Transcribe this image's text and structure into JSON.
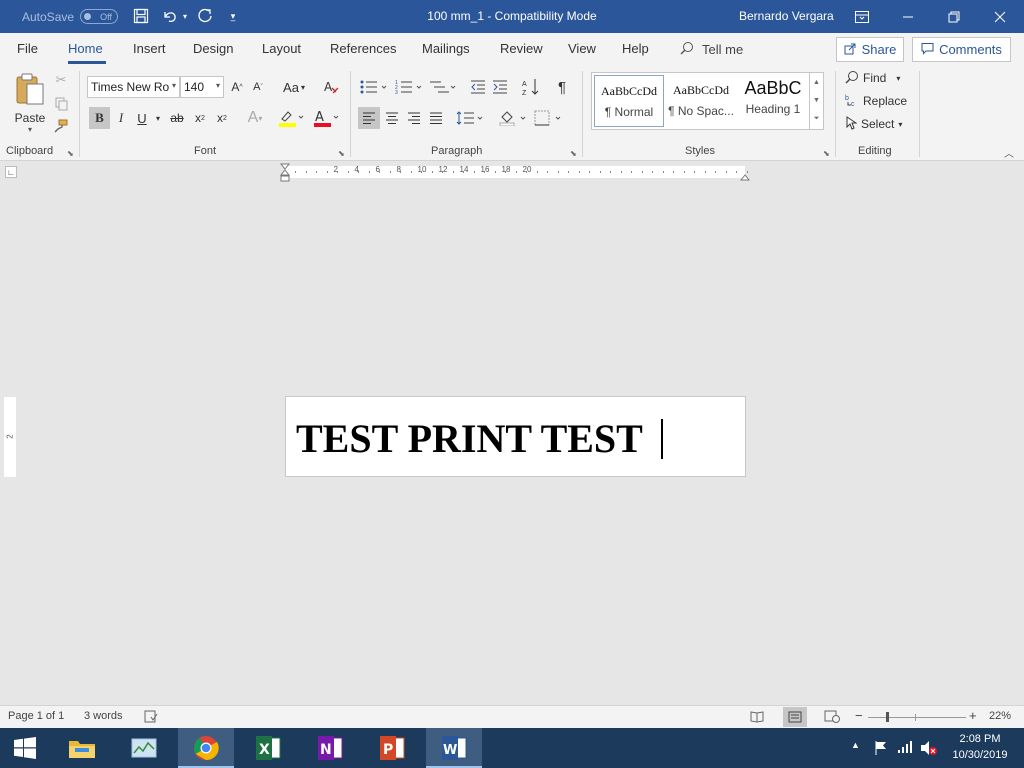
{
  "titlebar": {
    "autosave_label": "AutoSave",
    "autosave_state": "Off",
    "doc_title": "100 mm_1  -  Compatibility Mode",
    "user_name": "Bernardo Vergara"
  },
  "tabs": [
    {
      "label": "File"
    },
    {
      "label": "Home",
      "active": true
    },
    {
      "label": "Insert"
    },
    {
      "label": "Design"
    },
    {
      "label": "Layout"
    },
    {
      "label": "References"
    },
    {
      "label": "Mailings"
    },
    {
      "label": "Review"
    },
    {
      "label": "View"
    },
    {
      "label": "Help"
    }
  ],
  "tellme_label": "Tell me",
  "share_label": "Share",
  "comments_label": "Comments",
  "ribbon": {
    "clipboard": {
      "paste_label": "Paste",
      "group_label": "Clipboard"
    },
    "font": {
      "font_name": "Times New Ro",
      "font_size": "140",
      "change_case_label": "Aa",
      "group_label": "Font"
    },
    "paragraph": {
      "group_label": "Paragraph"
    },
    "styles": {
      "group_label": "Styles",
      "items": [
        {
          "preview": "AaBbCcDd",
          "name": "¶ Normal"
        },
        {
          "preview": "AaBbCcDd",
          "name": "¶ No Spac..."
        },
        {
          "preview": "AaBbC",
          "name": "Heading 1"
        }
      ]
    },
    "editing": {
      "find_label": "Find",
      "replace_label": "Replace",
      "select_label": "Select",
      "group_label": "Editing"
    }
  },
  "ruler_numbers": [
    "2",
    "4",
    "6",
    "8",
    "10",
    "12",
    "14",
    "16",
    "18",
    "20"
  ],
  "vruler_number": "2",
  "document": {
    "text": "TEST PRINT TEST"
  },
  "statusbar": {
    "page": "Page 1 of 1",
    "words": "3 words",
    "zoom": "22%"
  },
  "taskbar": {
    "time": "2:08 PM",
    "date": "10/30/2019"
  },
  "colors": {
    "brand": "#2b579a",
    "highlight": "#ffff00",
    "font_color": "#e81123"
  }
}
